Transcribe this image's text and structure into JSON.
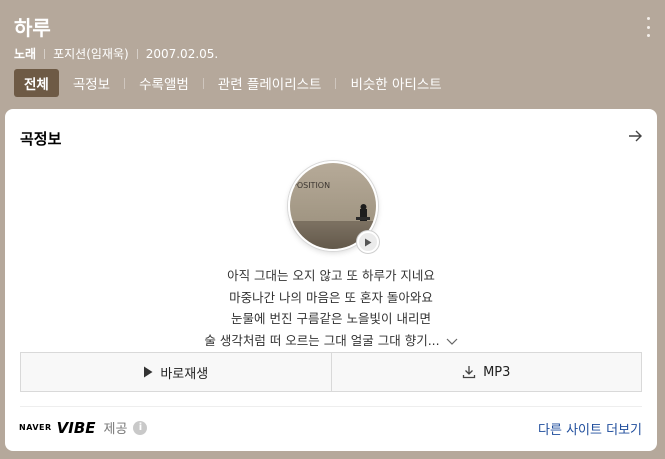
{
  "song": {
    "title": "하루",
    "type": "노래",
    "artist": "포지션(임재욱)",
    "date": "2007.02.05."
  },
  "tabs": [
    {
      "label": "전체",
      "active": true
    },
    {
      "label": "곡정보",
      "active": false
    },
    {
      "label": "수록앨범",
      "active": false
    },
    {
      "label": "관련 플레이리스트",
      "active": false
    },
    {
      "label": "비슷한 아티스트",
      "active": false
    }
  ],
  "card": {
    "title": "곡정보",
    "album_art_text": "POSITION",
    "lyrics": [
      "아직 그대는 오지 않고 또 하루가 지네요",
      "마중나간 나의 마음은 또 혼자 돌아와요",
      "눈물에 번진 구름같은 노을빛이 내리면",
      "술 생각처럼 떠 오르는 그대 얼굴 그대 향기..."
    ],
    "play_button": "바로재생",
    "mp3_button": "MP3",
    "provider_naver": "NAVER",
    "provider_vibe": "VIBE",
    "provider_label": "제공",
    "more_link": "다른 사이트 더보기"
  },
  "icons": {
    "more": "more-vertical-icon",
    "arrow": "arrow-right-icon",
    "play": "play-icon",
    "download": "download-icon",
    "info": "info-icon",
    "expand": "chevron-down-icon"
  },
  "colors": {
    "header_bg": "#b5a89b",
    "active_tab_bg": "#6e5a45",
    "link": "#1f4d9c"
  }
}
